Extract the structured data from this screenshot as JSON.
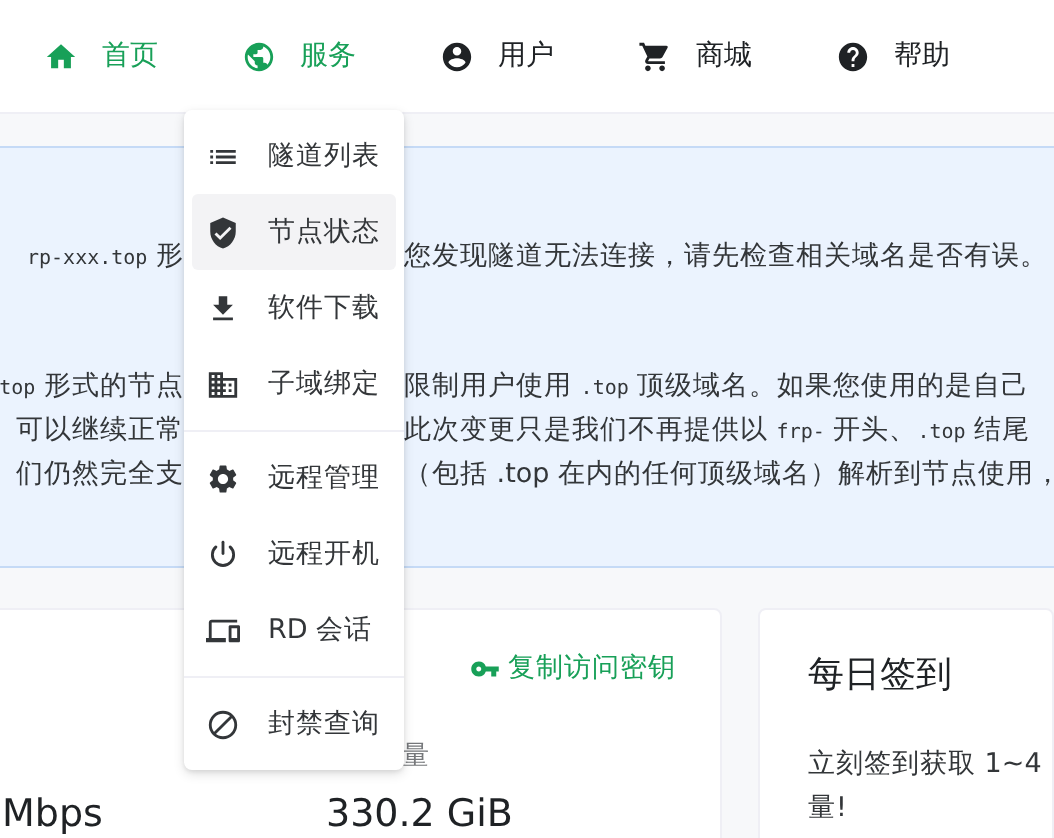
{
  "nav": [
    {
      "label": "首页",
      "active": true
    },
    {
      "label": "服务",
      "active": true
    },
    {
      "label": "用户",
      "active": false
    },
    {
      "label": "商城",
      "active": false
    },
    {
      "label": "帮助",
      "active": false
    }
  ],
  "service_menu": {
    "groups": [
      [
        {
          "label": "隧道列表",
          "selected": false
        },
        {
          "label": "节点状态",
          "selected": true
        },
        {
          "label": "软件下载",
          "selected": false
        },
        {
          "label": "子域绑定",
          "selected": false
        }
      ],
      [
        {
          "label": "远程管理",
          "selected": false
        },
        {
          "label": "远程开机",
          "selected": false
        },
        {
          "label": "RD 会话",
          "selected": false
        }
      ],
      [
        {
          "label": "封禁查询",
          "selected": false
        }
      ]
    ]
  },
  "notice": {
    "paragraphs": [
      [
        {
          "left": [
            {
              "kind": "code",
              "text": "rp-xxx.top"
            },
            {
              "kind": "text",
              "text": " 形"
            }
          ],
          "right": [
            {
              "kind": "text",
              "text": "您发现隧道无法连接，请先检查相关域名是否有误。"
            }
          ]
        }
      ],
      [
        {
          "left": [
            {
              "kind": "code",
              "text": "top"
            },
            {
              "kind": "text",
              "text": " 形式的节点"
            }
          ],
          "right": [
            {
              "kind": "text",
              "text": "限制用户使用 "
            },
            {
              "kind": "code",
              "text": ".top"
            },
            {
              "kind": "text",
              "text": " 顶级域名。如果您使用的是自己"
            }
          ]
        },
        {
          "left": [
            {
              "kind": "text",
              "text": "可以继续正常"
            }
          ],
          "right": [
            {
              "kind": "text",
              "text": "此次变更只是我们不再提供以 "
            },
            {
              "kind": "code",
              "text": "frp-"
            },
            {
              "kind": "text",
              "text": " 开头、"
            },
            {
              "kind": "code",
              "text": ".top"
            },
            {
              "kind": "text",
              "text": " 结尾"
            }
          ]
        },
        {
          "left": [
            {
              "kind": "text",
              "text": "们仍然完全支"
            }
          ],
          "right": [
            {
              "kind": "text",
              "text": "（包括 .top 在内的任何顶级域名）解析到节点使用，"
            }
          ]
        }
      ]
    ]
  },
  "stats_card": {
    "copy_key_link": "复制访问密钥",
    "stats": [
      {
        "value": "Mbps"
      },
      {
        "label": "量",
        "value": "330.2 GiB"
      }
    ]
  },
  "checkin_card": {
    "title": "每日签到",
    "text_lines": [
      "立刻签到获取 1~4",
      "量!"
    ]
  }
}
